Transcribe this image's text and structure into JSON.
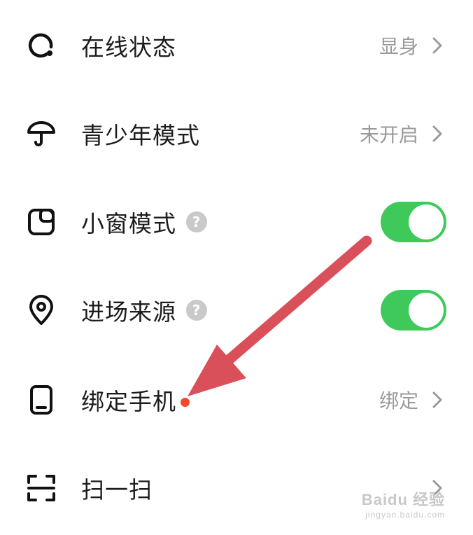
{
  "settings": {
    "online_status": {
      "label": "在线状态",
      "value": "显身",
      "icon": "online-status-icon"
    },
    "teen_mode": {
      "label": "青少年模式",
      "value": "未开启",
      "icon": "umbrella-icon"
    },
    "mini_window": {
      "label": "小窗模式",
      "help": "?",
      "toggle_on": true,
      "icon": "mini-window-icon"
    },
    "entry_source": {
      "label": "进场来源",
      "help": "?",
      "toggle_on": true,
      "icon": "location-pin-icon"
    },
    "bind_phone": {
      "label": "绑定手机",
      "value": "绑定",
      "has_red_dot": true,
      "icon": "phone-icon"
    },
    "scan": {
      "label": "扫一扫",
      "icon": "scan-icon"
    }
  },
  "annotation": {
    "arrow_color": "#d9505a",
    "icon": "red-arrow"
  },
  "watermark": {
    "brand": "Baidu 经验",
    "url": "jingyan.baidu.com"
  },
  "colors": {
    "toggle_on": "#3ec95a",
    "red_dot": "#f04a2e",
    "text": "#1c1c1c",
    "secondary": "#9a9a9a"
  }
}
